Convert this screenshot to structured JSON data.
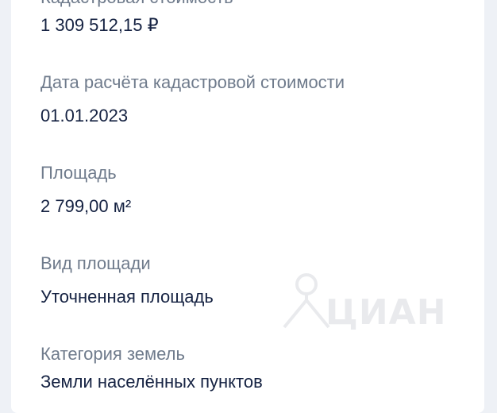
{
  "fields": [
    {
      "label": "Кадастровая стоимость",
      "value": "1 309 512,15 ₽"
    },
    {
      "label": "Дата расчёта кадастровой стоимости",
      "value": "01.01.2023"
    },
    {
      "label": "Площадь",
      "value": "2 799,00 м²"
    },
    {
      "label": "Вид площади",
      "value": "Уточненная площадь"
    },
    {
      "label": "Категория земель",
      "value": "Земли населённых пунктов"
    }
  ],
  "watermark": {
    "text": "ЦИАН",
    "icon": "cian-logo-icon"
  }
}
